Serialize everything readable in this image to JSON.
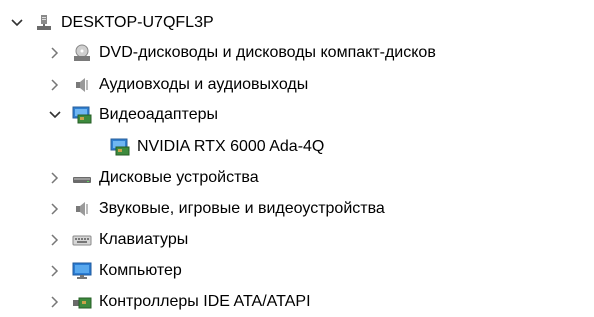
{
  "tree": {
    "root": {
      "label": "DESKTOP-U7QFL3P",
      "icon": "computer-icon",
      "expanded": true
    },
    "items": [
      {
        "label": "DVD-дисководы и дисководы компакт-дисков",
        "icon": "dvd-drive-icon",
        "expanded": false
      },
      {
        "label": "Аудиовходы и аудиовыходы",
        "icon": "speaker-icon",
        "expanded": false
      },
      {
        "label": "Видеоадаптеры",
        "icon": "display-adapter-icon",
        "expanded": true,
        "children": [
          {
            "label": "NVIDIA RTX 6000 Ada-4Q",
            "icon": "display-adapter-icon"
          }
        ]
      },
      {
        "label": "Дисковые устройства",
        "icon": "disk-drive-icon",
        "expanded": false
      },
      {
        "label": "Звуковые, игровые и видеоустройства",
        "icon": "speaker-icon",
        "expanded": false
      },
      {
        "label": "Клавиатуры",
        "icon": "keyboard-icon",
        "expanded": false
      },
      {
        "label": "Компьютер",
        "icon": "monitor-icon",
        "expanded": false
      },
      {
        "label": "Контроллеры IDE ATA/ATAPI",
        "icon": "controller-icon",
        "expanded": false
      }
    ]
  }
}
